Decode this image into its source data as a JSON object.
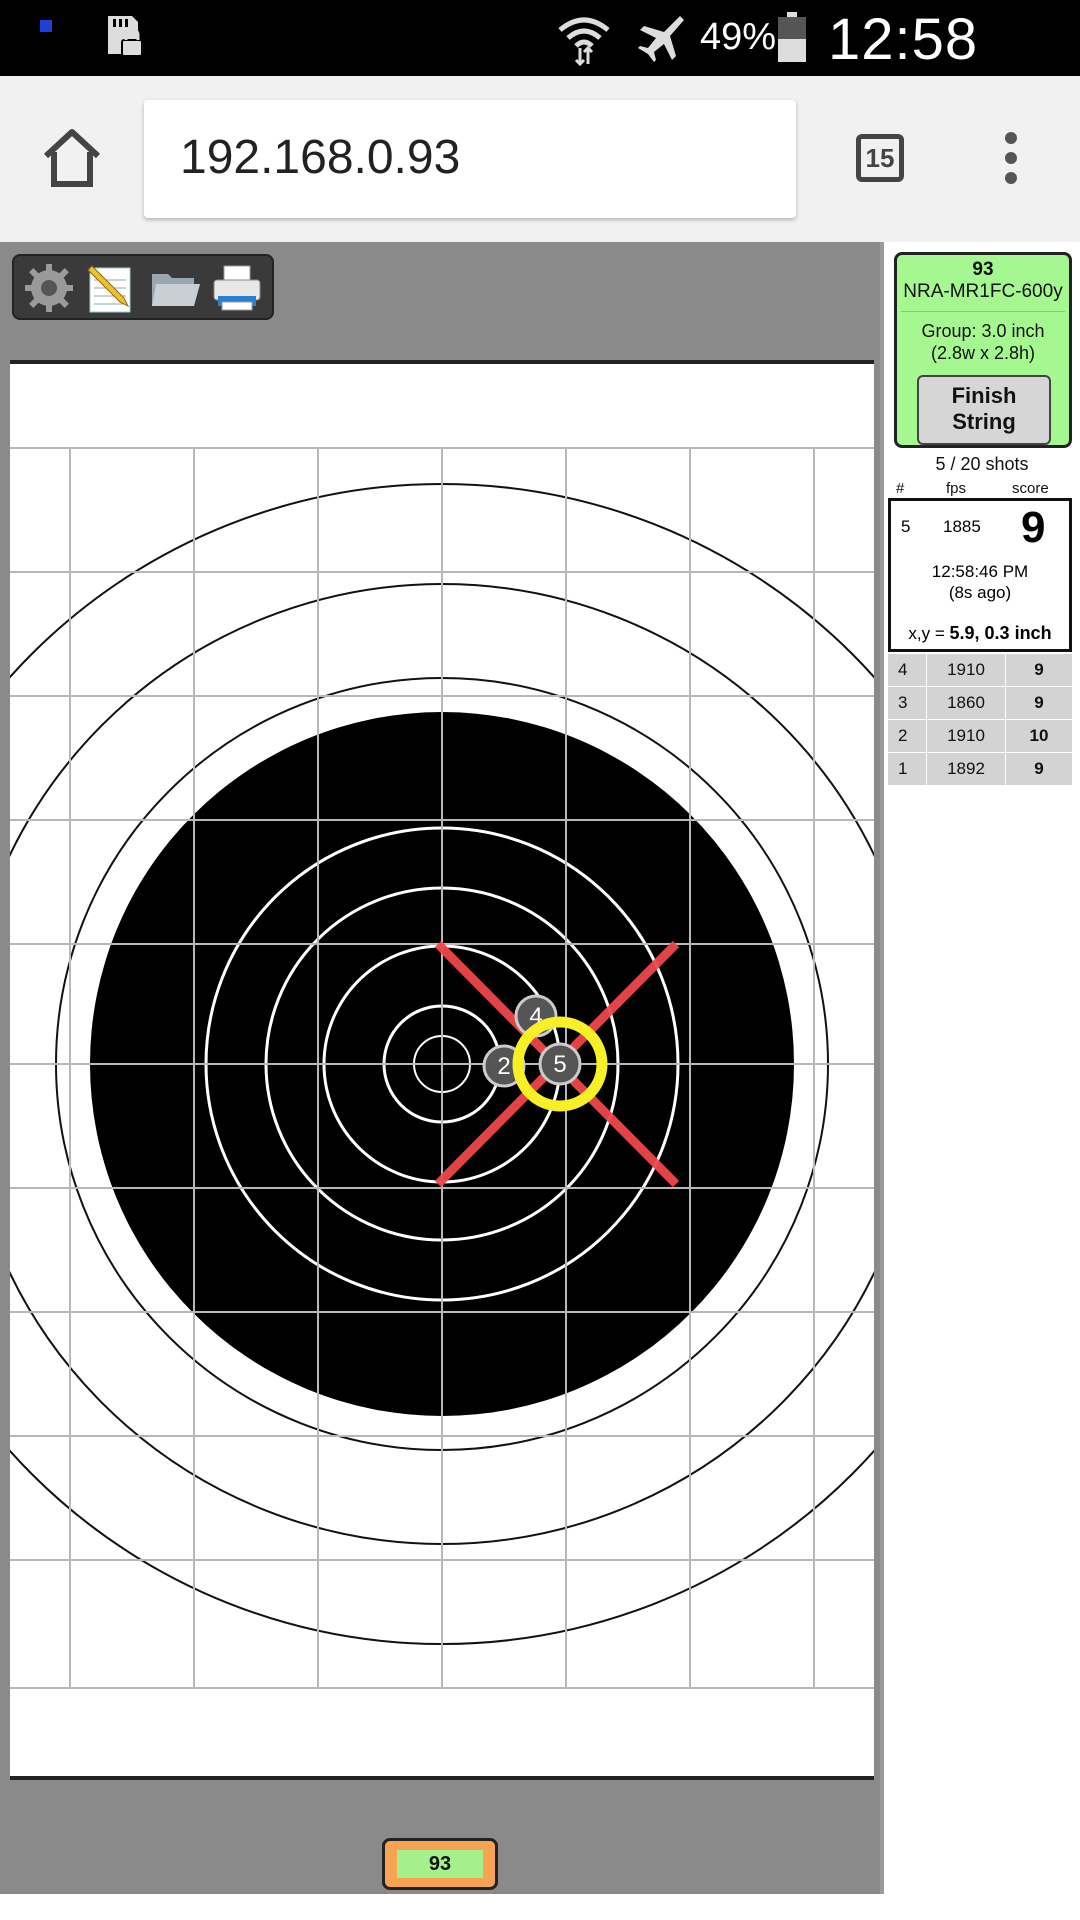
{
  "status_bar": {
    "battery_percent": "49%",
    "time": "12:58 PM"
  },
  "browser": {
    "url": "192.168.0.93",
    "tab_count": "15"
  },
  "toolbar": {
    "icons": [
      "gear-icon",
      "notepad-icon",
      "folder-icon",
      "printer-icon"
    ]
  },
  "target": {
    "shot_markers": [
      {
        "label": "4"
      },
      {
        "label": "2"
      },
      {
        "label": "5"
      }
    ]
  },
  "bottom_badge": "93",
  "panel": {
    "target_number": "93",
    "target_name": "NRA-MR1FC-600y",
    "group_line1": "Group: 3.0 inch",
    "group_line2": "(2.8w x 2.8h)",
    "finish_line1": "Finish",
    "finish_line2": "String",
    "shots_count": "5 / 20 shots",
    "col_num": "#",
    "col_fps": "fps",
    "col_score": "score",
    "current": {
      "index": "5",
      "fps": "1885",
      "score": "9",
      "time": "12:58:46 PM",
      "ago": "(8s ago)",
      "xy_label": "x,y = ",
      "xy_value": "5.9, 0.3 inch"
    },
    "history": [
      {
        "index": "4",
        "fps": "1910",
        "score": "9"
      },
      {
        "index": "3",
        "fps": "1860",
        "score": "9"
      },
      {
        "index": "2",
        "fps": "1910",
        "score": "10"
      },
      {
        "index": "1",
        "fps": "1892",
        "score": "9"
      }
    ]
  }
}
